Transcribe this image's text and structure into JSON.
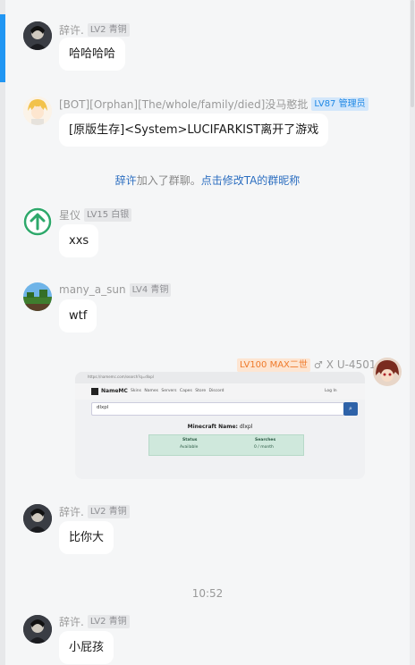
{
  "messages": [
    {
      "user": "辞许.",
      "badge": "LV2 青铜",
      "text": "哈哈哈哈"
    },
    {
      "user": "[BOT][Orphan][The/whole/family/died]没马憨批",
      "badge": "LV87 管理员",
      "text": "[原版生存]<System>LUCIFARKIST离开了游戏"
    },
    {
      "system_name": "辞许",
      "system_text": "加入了群聊。",
      "system_link": "点击修改TA的群昵称"
    },
    {
      "user": "星仪",
      "badge": "LV15 白银",
      "text": "xxs"
    },
    {
      "user": "many_a_sun",
      "badge": "LV4 青铜",
      "text": "wtf"
    },
    {
      "user": "X U-4501",
      "badge": "LV100 MAX二世",
      "gender_icon": "♂"
    },
    {
      "user": "辞许.",
      "badge": "LV2 青铜",
      "text": "比你大"
    },
    {
      "time": "10:52"
    },
    {
      "user": "辞许.",
      "badge": "LV2 青铜",
      "text": "小屁孩"
    }
  ],
  "screenshot": {
    "url": "https://namemc.com/search?q=dlxpl",
    "brand": "NameMC",
    "nav": "Skins  Names  Servers  Capes  Store  Discord",
    "login": "Log In",
    "search_value": "dlxpl",
    "result_label": "Minecraft Name:",
    "result_value": "dlxpl",
    "col1_header": "Status",
    "col1_value": "Available",
    "col2_header": "Searches",
    "col2_value": "0 / month"
  },
  "colors": {
    "accent": "#2196f3",
    "link": "#2c6ec0",
    "badge_admin": "#1e88e5",
    "badge_max": "#ef7a2b"
  },
  "icons": {
    "user1": "avatar-anime-dark",
    "bot": "avatar-anime-blonde",
    "xingyi": "up-arrow-circle-icon",
    "many_a_sun": "avatar-minecraft-landscape",
    "xu": "avatar-anime-red",
    "search": "search-icon"
  }
}
